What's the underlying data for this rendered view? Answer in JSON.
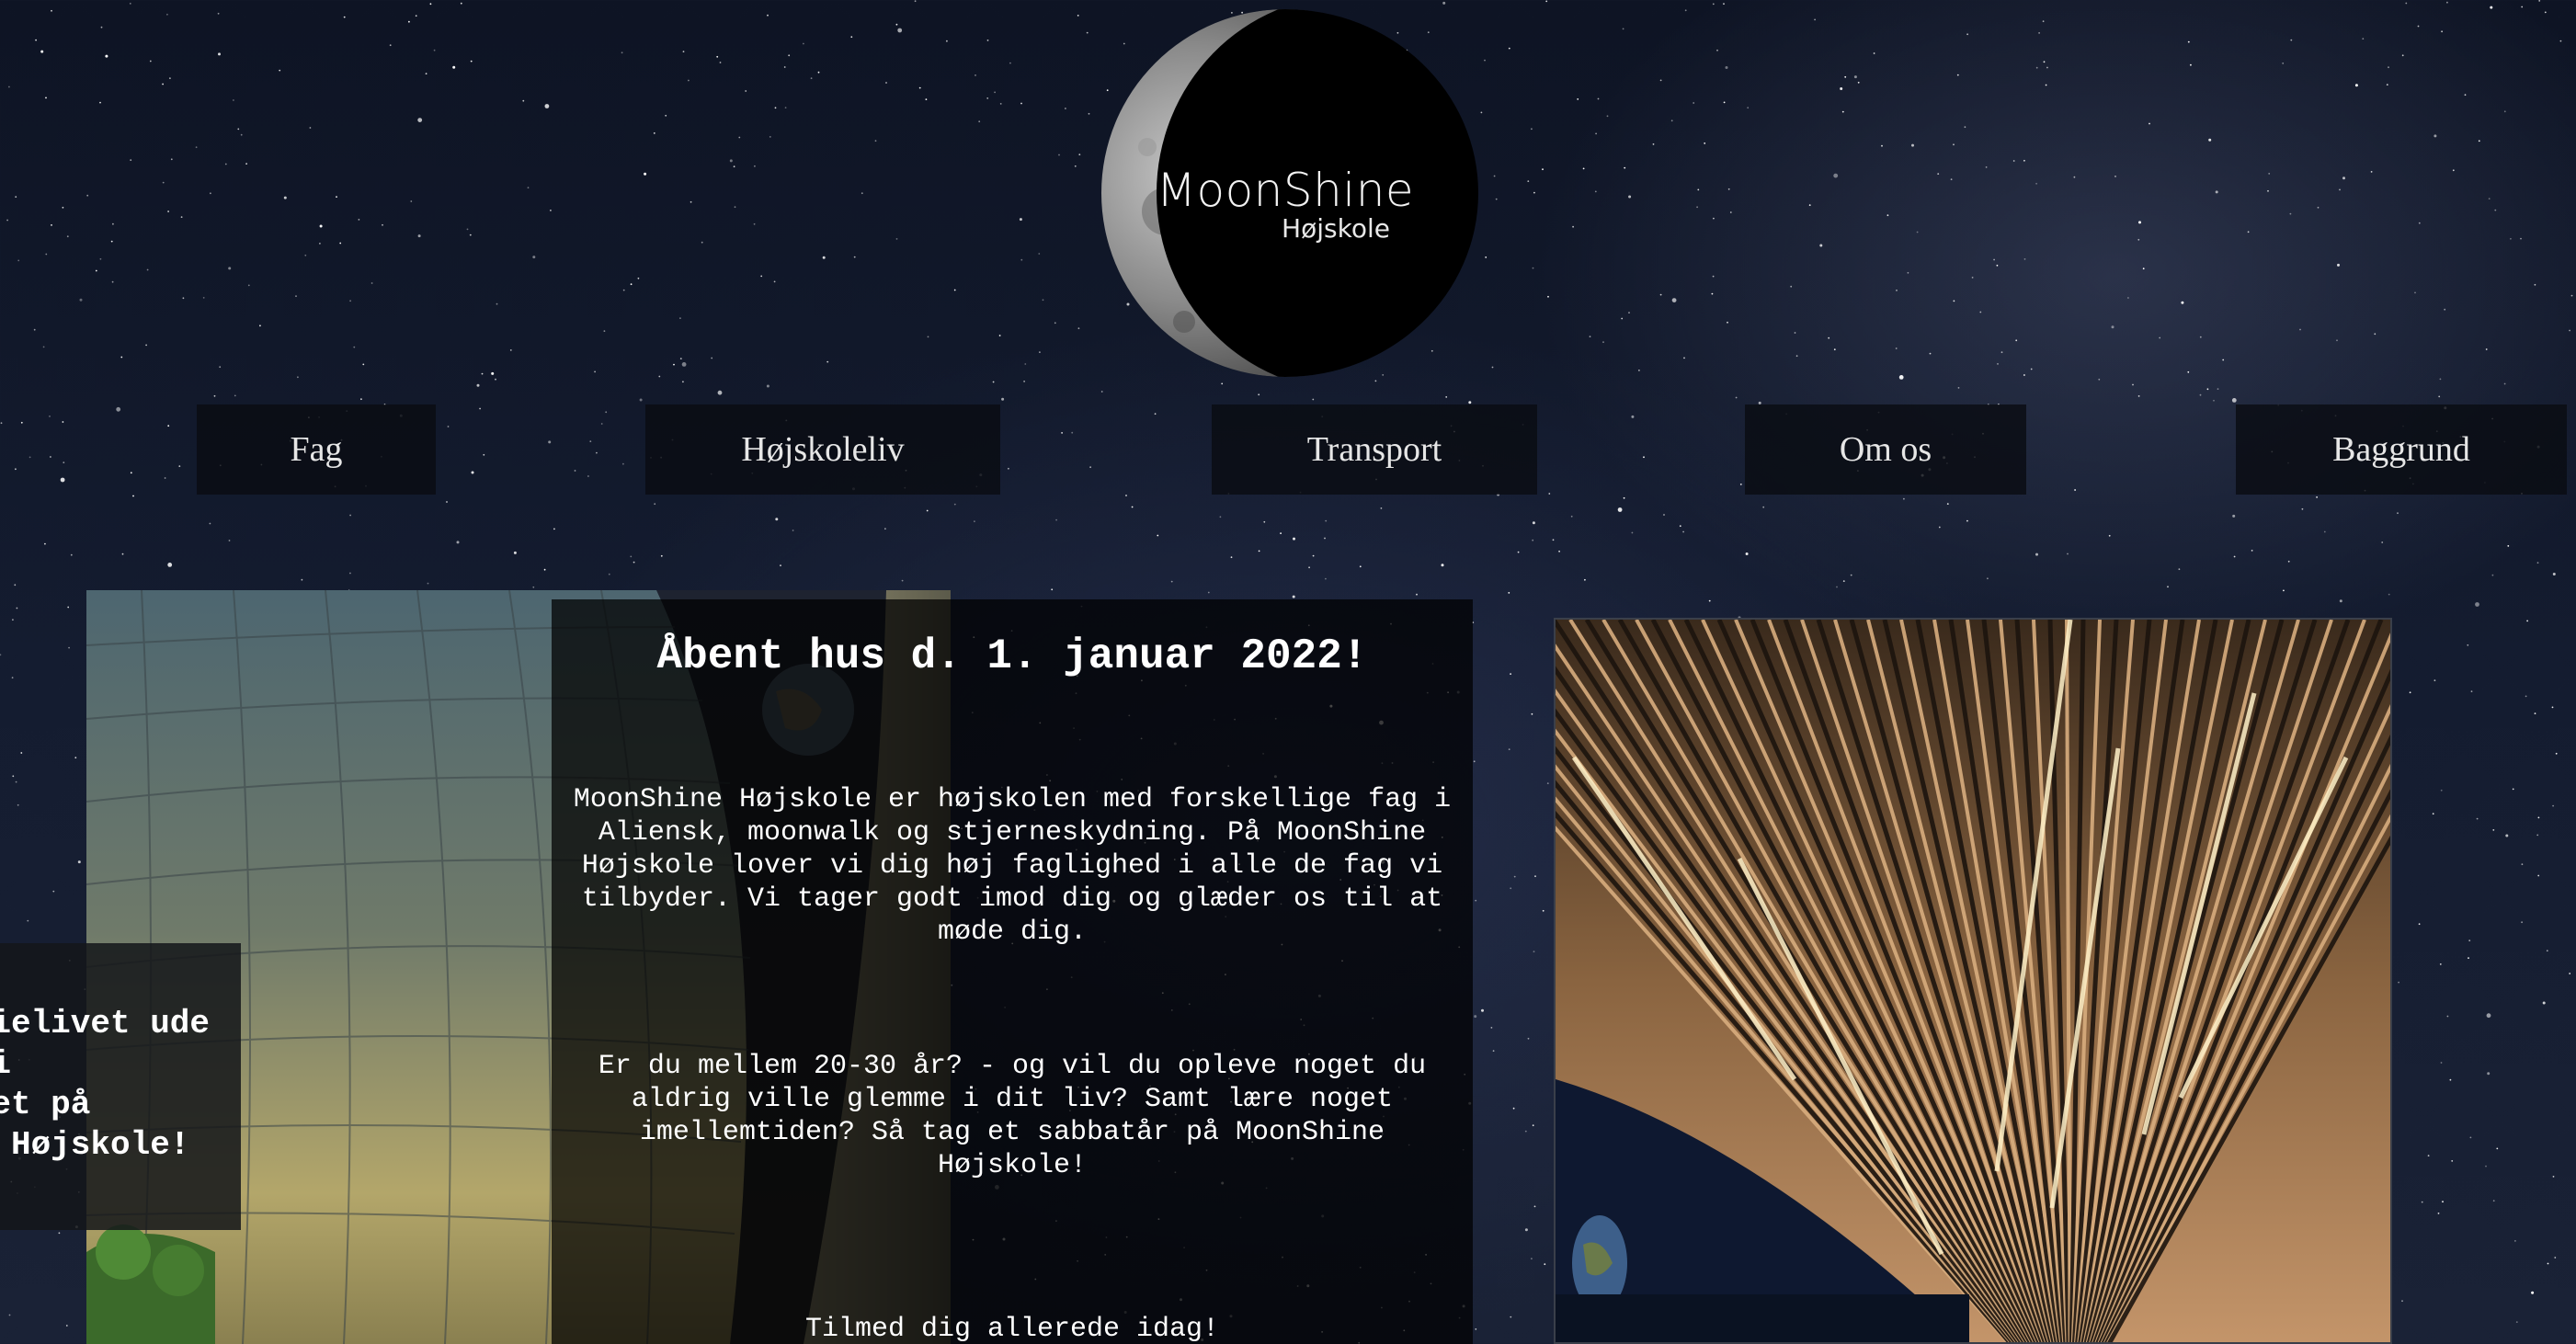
{
  "logo": {
    "title": "MoonShine",
    "subtitle": "Højskole",
    "icon": "moon-logo-icon"
  },
  "nav": {
    "items": [
      {
        "label": "Fag"
      },
      {
        "label": "Højskoleliv"
      },
      {
        "label": "Transport"
      },
      {
        "label": "Om os"
      },
      {
        "label": "Baggrund"
      }
    ]
  },
  "side_box": {
    "lines": "ielivet ude\ni\net på\n Højskole!"
  },
  "main": {
    "title": "Åbent hus d. 1. januar 2022!",
    "paragraph1": "MoonShine Højskole er højskolen med forskellige fag i Aliensk, moonwalk og stjerneskydning. På MoonShine Højskole lover vi dig høj faglighed i alle de fag vi tilbyder. Vi tager godt imod dig og glæder os til at møde dig.",
    "paragraph2": "Er du mellem 20-30 år? - og vil du opleve noget du aldrig ville glemme i dit liv? Samt lære noget imellemtiden? Så tag et sabbatår på MoonShine Højskole!",
    "paragraph3": "Tilmed dig allerede idag!"
  },
  "colors": {
    "background": "#141c30",
    "nav_bg": "#0a0c12",
    "panel_bg": "#000000",
    "text": "#ffffff"
  }
}
